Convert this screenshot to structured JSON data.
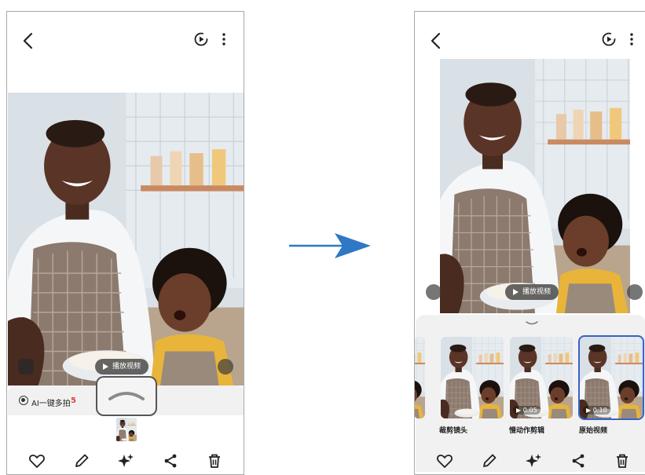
{
  "left_screen": {
    "play_video_label": "播放视频",
    "ai_multi_shot": {
      "label": "AI一键多拍",
      "count": "5"
    }
  },
  "right_screen": {
    "play_video_label": "播放视频",
    "clips": [
      {
        "label": "裁剪镜头",
        "duration": ""
      },
      {
        "label": "慢动作剪辑",
        "duration": "0:05"
      },
      {
        "label": "原始视频",
        "duration": "0:10",
        "selected": true
      }
    ]
  },
  "icons": {
    "back": "chevron-left-icon",
    "motion_photo": "motion-photo-icon",
    "more": "more-vertical-icon",
    "favorite": "heart-icon",
    "edit": "pencil-icon",
    "effects": "sparkle-icon",
    "share": "share-icon",
    "delete": "trash-icon",
    "arrow": "arrow-right-icon"
  },
  "colors": {
    "accent_blue": "#2e78c4",
    "ai_count_red": "#e04040",
    "selected_outline": "#3a62c9"
  }
}
